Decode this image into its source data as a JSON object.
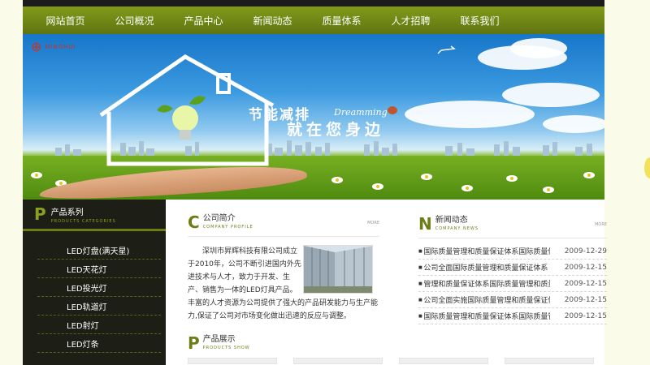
{
  "nav": [
    "网站首页",
    "公司概况",
    "产品中心",
    "新闻动态",
    "质量体系",
    "人才招聘",
    "联系我们"
  ],
  "banner": {
    "logo_text": "MINGHUI",
    "slogan_cn_1": "节能减排",
    "slogan_en": "Dreamming",
    "slogan_cn_2": "就在您身边"
  },
  "sidebar": {
    "title": "产品系列",
    "subtitle": "PRODUCTS CATEGORIES",
    "items": [
      "LED灯盘(满天星)",
      "LED天花灯",
      "LED投光灯",
      "LED轨道灯",
      "LED射灯",
      "LED灯条"
    ]
  },
  "profile": {
    "title": "公司简介",
    "subtitle": "COMPANY PROFILE",
    "more": "MORE",
    "lines": [
      "　　深圳市昇辉科技有限公司成立",
      "于2010年，公司不断引进国内外先",
      "进技术与人才，致力于开发、生",
      "产、销售为一体的LED灯具产品。",
      "丰富的人才资源为公司提供了强大的产品研发能力与生产能",
      "力,保证了公司对市场变化做出迅速的反应与调整。"
    ]
  },
  "news": {
    "title": "新闻动态",
    "subtitle": "COMPANY NEWS",
    "more": "MORE",
    "items": [
      {
        "title": "国际质量管理和质量保证体系国际质量体",
        "date": "2009-12-29"
      },
      {
        "title": "公司全面国际质量管理和质量保证体系",
        "date": "2009-12-15"
      },
      {
        "title": "管理和质量保证体系国际质量管理和质量",
        "date": "2009-12-15"
      },
      {
        "title": "公司全面实施国际质量管理和质量保证体",
        "date": "2009-12-15"
      },
      {
        "title": "国际质量管理和质量保证体系国际质量管",
        "date": "2009-12-15"
      }
    ]
  },
  "products": {
    "title": "产品展示",
    "subtitle": "PRODUCTS SHOW"
  },
  "colors": {
    "accent": "#6d7d16",
    "nav_bg": "#718617",
    "sidebar_bg": "#1d1f17",
    "page_bg": "#fbfbe9"
  }
}
